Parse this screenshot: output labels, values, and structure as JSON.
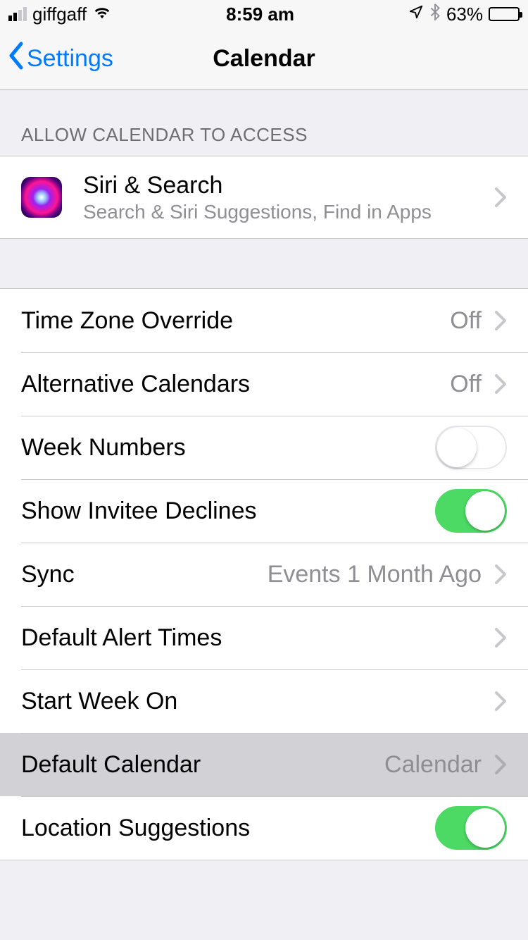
{
  "status": {
    "carrier": "giffgaff",
    "time": "8:59 am",
    "battery_pct": "63%",
    "location_icon": "location-arrow",
    "bluetooth_icon": "bluetooth",
    "wifi_icon": "wifi"
  },
  "nav": {
    "back_label": "Settings",
    "title": "Calendar"
  },
  "sections": {
    "access_header": "ALLOW CALENDAR TO ACCESS",
    "siri": {
      "title": "Siri & Search",
      "subtitle": "Search & Siri Suggestions, Find in Apps"
    },
    "rows": {
      "time_zone_override": {
        "label": "Time Zone Override",
        "value": "Off"
      },
      "alternative_calendars": {
        "label": "Alternative Calendars",
        "value": "Off"
      },
      "week_numbers": {
        "label": "Week Numbers",
        "toggle": "off"
      },
      "show_invitee_declines": {
        "label": "Show Invitee Declines",
        "toggle": "on"
      },
      "sync": {
        "label": "Sync",
        "value": "Events 1 Month Ago"
      },
      "default_alert_times": {
        "label": "Default Alert Times"
      },
      "start_week_on": {
        "label": "Start Week On"
      },
      "default_calendar": {
        "label": "Default Calendar",
        "value": "Calendar"
      },
      "location_suggestions": {
        "label": "Location Suggestions",
        "toggle": "on"
      }
    }
  }
}
